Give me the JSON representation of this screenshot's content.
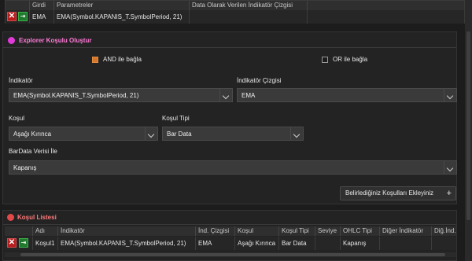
{
  "top_grid": {
    "headers": [
      "Girdi",
      "Parametreler",
      "Data Olarak Verilen İndikatör Çizgisi"
    ],
    "row": {
      "girdi": "EMA",
      "parametreler": "EMA(Symbol.KAPANIS_T.SymbolPeriod, 21)",
      "cizgi": ""
    }
  },
  "explorer": {
    "title": "Explorer Koşulu Oluştur",
    "and_label": "AND ile bağla",
    "and_checked": true,
    "or_label": "OR ile bağla",
    "or_checked": false,
    "indikator_label": "İndikatör",
    "indikator_value": "EMA(Symbol.KAPANIS_T.SymbolPeriod, 21)",
    "cizgi_label": "İndikatör Çizgisi",
    "cizgi_value": "EMA",
    "kosul_label": "Koşul",
    "kosul_value": "Aşağı Kırınca",
    "kosul_tipi_label": "Koşul Tipi",
    "kosul_tipi_value": "Bar Data",
    "bardata_label": "BarData Verisi İle",
    "bardata_value": "Kapanış",
    "add_button": "Belirlediğiniz Koşulları Ekleyiniz"
  },
  "list": {
    "title": "Koşul Listesi",
    "headers": [
      "Adı",
      "İndikatör",
      "İnd. Çizgisi",
      "Koşul",
      "Koşul Tipi",
      "Seviye",
      "OHLC Tipi",
      "Diğer İndikatör",
      "Diğ.İnd."
    ],
    "row": [
      "Koşul1",
      "EMA(Symbol.KAPANIS_T.SymbolPeriod, 21)",
      "EMA",
      "Aşağı Kırınca",
      "Bar Data",
      "",
      "Kapanış",
      "",
      ""
    ]
  },
  "colors": {
    "accent_orange": "#d5752c",
    "title_red": "#ff7a7a",
    "dot_magenta": "#e23ad8",
    "dot_red": "#e24848"
  },
  "icons": {
    "delete": "close-icon",
    "add": "add-row-icon",
    "plus": "plus-icon"
  }
}
